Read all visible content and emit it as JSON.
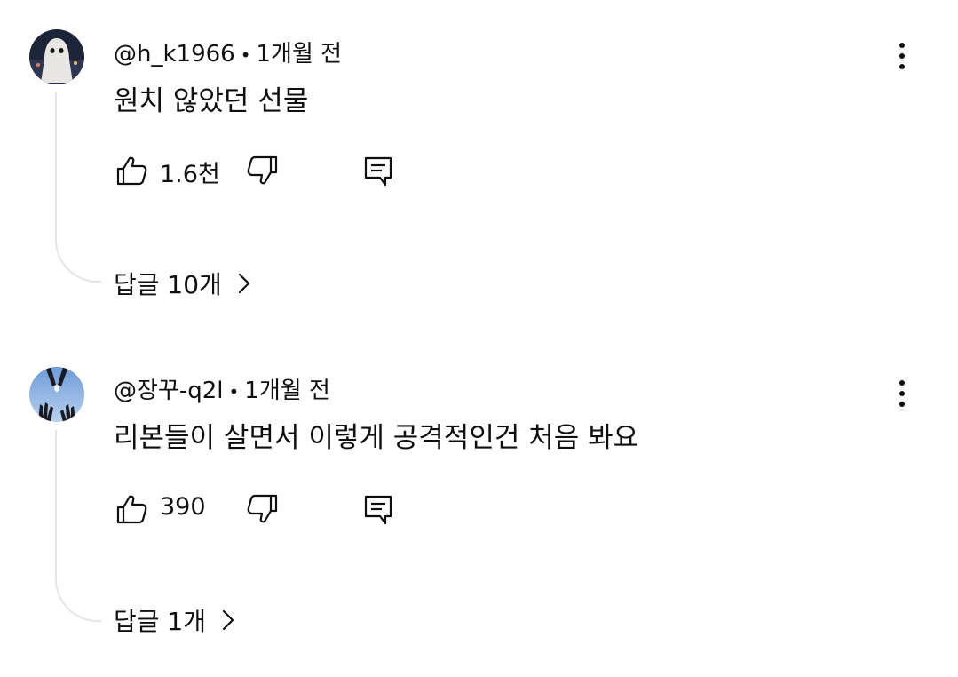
{
  "comments": [
    {
      "author": "@h_k1966",
      "time": "1개월 전",
      "separator": "•",
      "text": "원치 않았던 선물",
      "likes": "1.6천",
      "replies_label": "답글 10개",
      "avatar_icon": "ghost-sheet-avatar"
    },
    {
      "author": "@장꾸-q2l",
      "time": "1개월 전",
      "separator": "•",
      "text": "리본들이 살면서 이렇게 공격적인건 처음 봐요",
      "likes": "390",
      "replies_label": "답글 1개",
      "avatar_icon": "hands-sky-avatar"
    }
  ],
  "icons": {
    "like": "thumbs-up-icon",
    "dislike": "thumbs-down-icon",
    "reply": "reply-comment-icon",
    "more": "more-vertical-icon",
    "chevron": "chevron-right-icon"
  },
  "colors": {
    "text": "#0f0f0f",
    "thread_line": "#e5e5e5",
    "background": "#ffffff"
  }
}
